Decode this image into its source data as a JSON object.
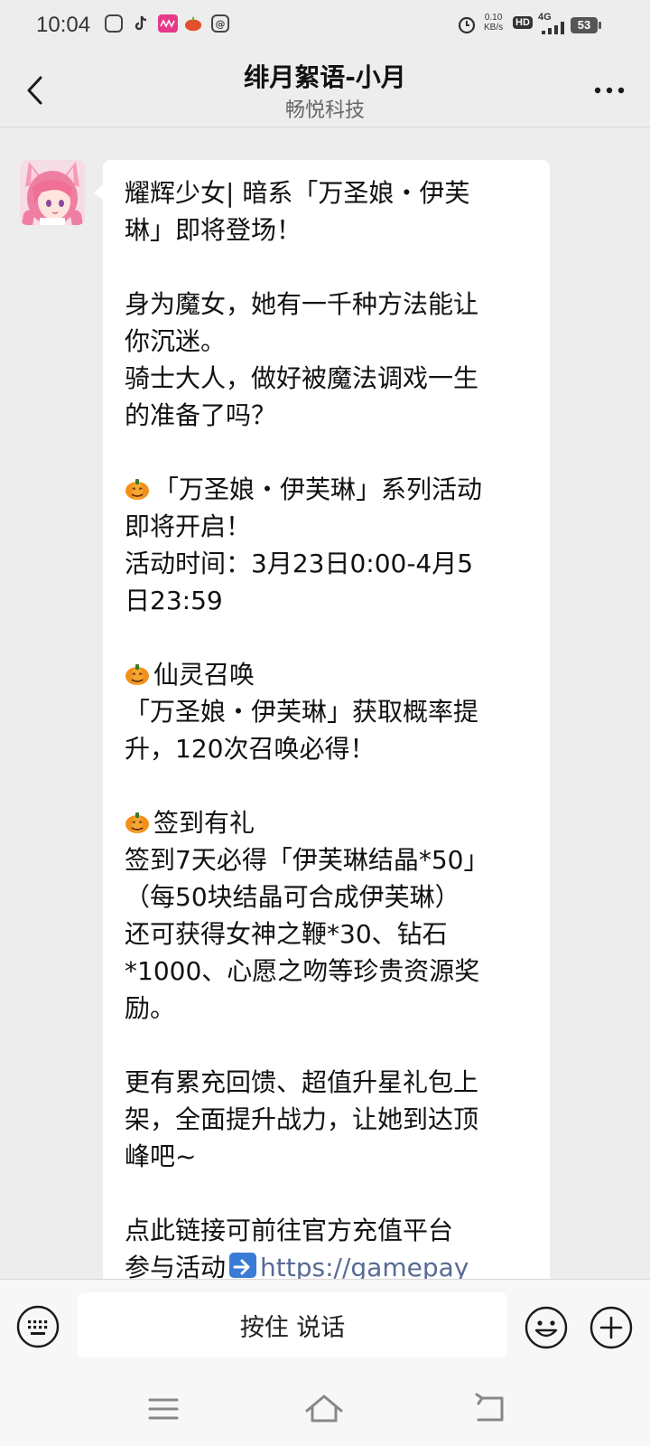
{
  "status_bar": {
    "time": "10:04",
    "speed": "0.10",
    "speed_unit": "KB/s",
    "hd": "HD",
    "network": "4G",
    "battery": "53"
  },
  "header": {
    "title": "绯月絮语-小月",
    "subtitle": "畅悦科技"
  },
  "message": {
    "lines": [
      "耀辉少女| 暗系「万圣娘・伊芙",
      "琳」即将登场！",
      "",
      "身为魔女，她有一千种方法能让",
      "你沉迷。",
      "骑士大人，做好被魔法调戏一生",
      "的准备了吗？",
      "",
      "「万圣娘・伊芙琳」系列活动",
      "即将开启！",
      "活动时间：3月23日0:00-4月5",
      "日23:59",
      "",
      "仙灵召唤",
      "「万圣娘・伊芙琳」获取概率提",
      "升，120次召唤必得！",
      "",
      "签到有礼",
      "签到7天必得「伊芙琳结晶*50」",
      "（每50块结晶可合成伊芙琳）",
      "还可获得女神之鞭*30、钻石",
      "*1000、心愿之吻等珍贵资源奖",
      "励。",
      "",
      "更有累充回馈、超值升星礼包上",
      "架，全面提升战力，让她到达顶",
      "峰吧~",
      "",
      "点此链接可前往官方充值平台",
      "参与活动",
      "https://gamepay"
    ]
  },
  "input_bar": {
    "voice_label": "按住 说话"
  },
  "colors": {
    "background": "#ededed",
    "bubble": "#ffffff",
    "link": "#576b95"
  }
}
